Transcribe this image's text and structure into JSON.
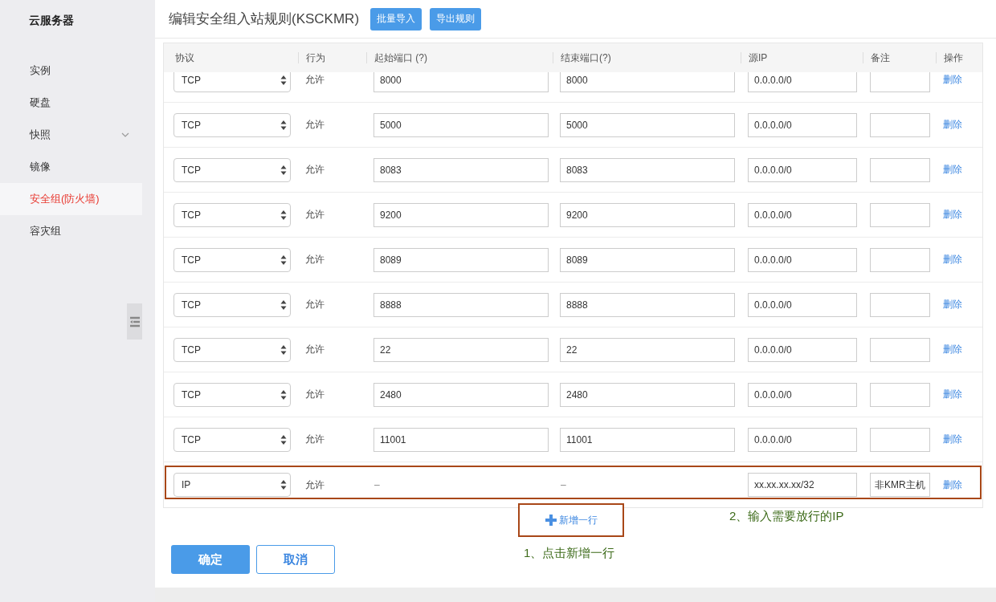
{
  "sidebar": {
    "title": "云服务器",
    "items": [
      {
        "label": "实例",
        "selected": false
      },
      {
        "label": "硬盘",
        "selected": false
      },
      {
        "label": "快照",
        "selected": false,
        "expanded": false
      },
      {
        "label": "镜像",
        "selected": false
      },
      {
        "label": "安全组(防火墙)",
        "selected": true
      },
      {
        "label": "容灾组",
        "selected": false
      }
    ]
  },
  "header": {
    "title": "编辑安全组入站规则(KSCKMR)",
    "buttons": [
      "批量导入",
      "导出规则"
    ]
  },
  "table": {
    "columns": [
      "协议",
      "行为",
      "起始端口 (?)",
      "结束端口(?)",
      "源IP",
      "备注",
      "操作"
    ],
    "rows": [
      {
        "kind": "port",
        "protocol": "TCP",
        "action": "允许",
        "start_port": "8000",
        "end_port": "8000",
        "source_ip": "0.0.0.0/0",
        "note": "",
        "delete": "删除",
        "highlighted": false
      },
      {
        "kind": "port",
        "protocol": "TCP",
        "action": "允许",
        "start_port": "5000",
        "end_port": "5000",
        "source_ip": "0.0.0.0/0",
        "note": "",
        "delete": "删除",
        "highlighted": false
      },
      {
        "kind": "port",
        "protocol": "TCP",
        "action": "允许",
        "start_port": "8083",
        "end_port": "8083",
        "source_ip": "0.0.0.0/0",
        "note": "",
        "delete": "删除",
        "highlighted": false
      },
      {
        "kind": "port",
        "protocol": "TCP",
        "action": "允许",
        "start_port": "9200",
        "end_port": "9200",
        "source_ip": "0.0.0.0/0",
        "note": "",
        "delete": "删除",
        "highlighted": false
      },
      {
        "kind": "port",
        "protocol": "TCP",
        "action": "允许",
        "start_port": "8089",
        "end_port": "8089",
        "source_ip": "0.0.0.0/0",
        "note": "",
        "delete": "删除",
        "highlighted": false
      },
      {
        "kind": "port",
        "protocol": "TCP",
        "action": "允许",
        "start_port": "8888",
        "end_port": "8888",
        "source_ip": "0.0.0.0/0",
        "note": "",
        "delete": "删除",
        "highlighted": false
      },
      {
        "kind": "port",
        "protocol": "TCP",
        "action": "允许",
        "start_port": "22",
        "end_port": "22",
        "source_ip": "0.0.0.0/0",
        "note": "",
        "delete": "删除",
        "highlighted": false
      },
      {
        "kind": "port",
        "protocol": "TCP",
        "action": "允许",
        "start_port": "2480",
        "end_port": "2480",
        "source_ip": "0.0.0.0/0",
        "note": "",
        "delete": "删除",
        "highlighted": false
      },
      {
        "kind": "port",
        "protocol": "TCP",
        "action": "允许",
        "start_port": "11001",
        "end_port": "11001",
        "source_ip": "0.0.0.0/0",
        "note": "",
        "delete": "删除",
        "highlighted": false
      },
      {
        "kind": "ip",
        "protocol": "IP",
        "action": "允许",
        "start_port": "–",
        "end_port": "–",
        "source_ip": "xx.xx.xx.xx/32",
        "note": "非KMR主机",
        "delete": "删除",
        "highlighted": true
      }
    ]
  },
  "add_row": {
    "label": "新增一行",
    "highlighted": true
  },
  "annotations": [
    {
      "kind": "add",
      "text": "1、点击新增一行"
    },
    {
      "kind": "ip",
      "text": "2、输入需要放行的IP"
    }
  ],
  "footer": {
    "buttons": [
      {
        "label": "确定",
        "kind": "primary"
      },
      {
        "label": "取消",
        "kind": "secondary"
      }
    ]
  }
}
